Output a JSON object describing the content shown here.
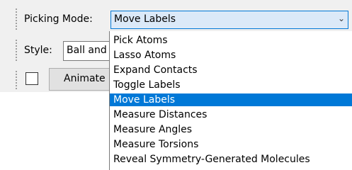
{
  "picking_mode": {
    "label": "Picking Mode:",
    "value": "Move Labels",
    "arrow": "⌄",
    "options": [
      {
        "label": "Pick Atoms",
        "selected": false
      },
      {
        "label": "Lasso Atoms",
        "selected": false
      },
      {
        "label": "Expand Contacts",
        "selected": false
      },
      {
        "label": "Toggle Labels",
        "selected": false
      },
      {
        "label": "Move Labels",
        "selected": true
      },
      {
        "label": "Measure Distances",
        "selected": false
      },
      {
        "label": "Measure Angles",
        "selected": false
      },
      {
        "label": "Measure Torsions",
        "selected": false
      },
      {
        "label": "Reveal Symmetry-Generated Molecules",
        "selected": false
      }
    ]
  },
  "style": {
    "label": "Style:",
    "value": "Ball and"
  },
  "animate": {
    "checked": false,
    "button_label": "Animate"
  },
  "colors": {
    "accent": "#0078d7",
    "selected_text": "#ffffff",
    "toolbar_bg": "#f0f0f0"
  }
}
